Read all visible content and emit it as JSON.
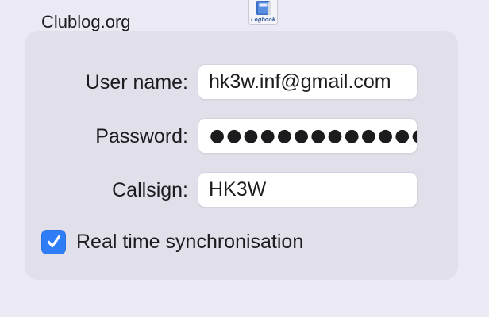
{
  "app_icon": {
    "name": "logbook-app-icon",
    "label": "Logbook"
  },
  "section": {
    "title": "Clublog.org"
  },
  "form": {
    "username": {
      "label": "User name:",
      "value": "hk3w.inf@gmail.com"
    },
    "password": {
      "label": "Password:",
      "masked_display": "●●●●●●●●●●●●●●●●●"
    },
    "callsign": {
      "label": "Callsign:",
      "value": "HK3W"
    },
    "realtime_sync": {
      "label": "Real time synchronisation",
      "checked": true
    }
  },
  "colors": {
    "accent": "#2f7df6",
    "background": "#ebeaf4",
    "panel": "#e0dfea"
  }
}
